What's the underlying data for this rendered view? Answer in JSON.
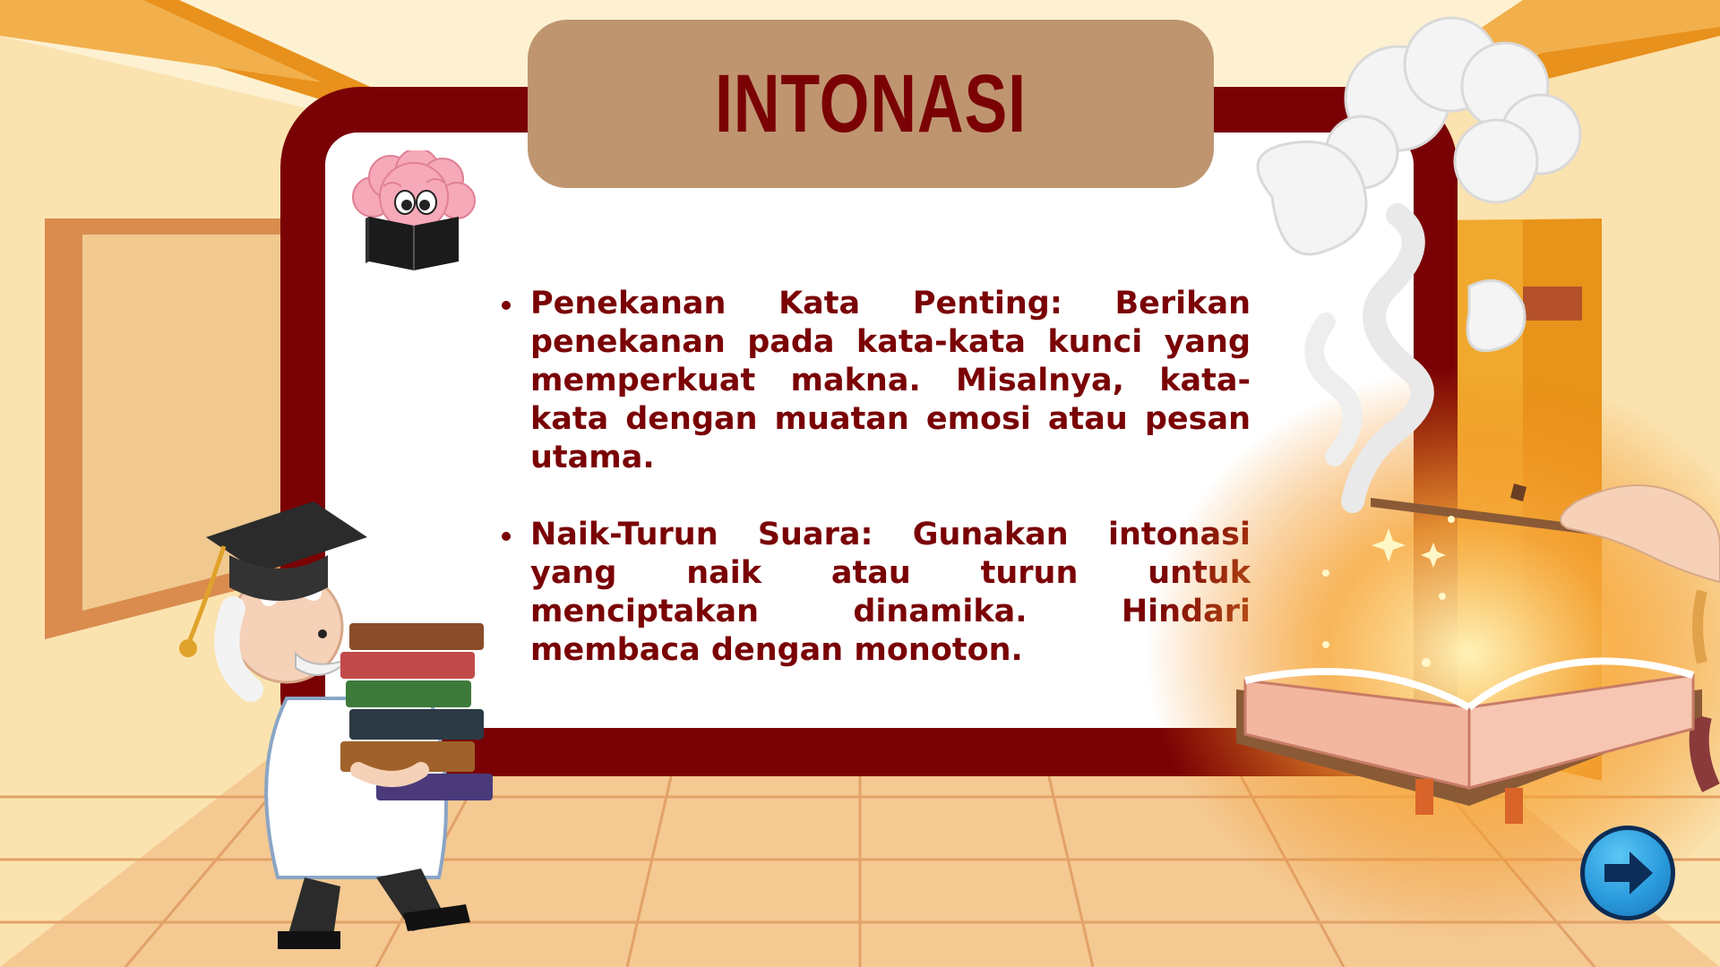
{
  "slide": {
    "title": "INTONASI",
    "bullets": [
      {
        "text": "Penekanan Kata Penting: Berikan penekanan pada kata-kata kunci yang memperkuat makna. Misalnya, kata-kata dengan muatan emosi atau pesan utama."
      },
      {
        "text": "Naik-Turun Suara: Gunakan intonasi yang naik atau turun untuk menciptakan dinamika. Hindari membaca dengan monoton."
      }
    ]
  },
  "navigation": {
    "next_icon": "arrow-right-icon"
  },
  "colors": {
    "accent": "#7a0205",
    "title_box": "#bf9570",
    "wall": "#fdf1d2",
    "floor": "#f3c48a",
    "beam": "#e8911c",
    "button": "#2a9bdc"
  }
}
